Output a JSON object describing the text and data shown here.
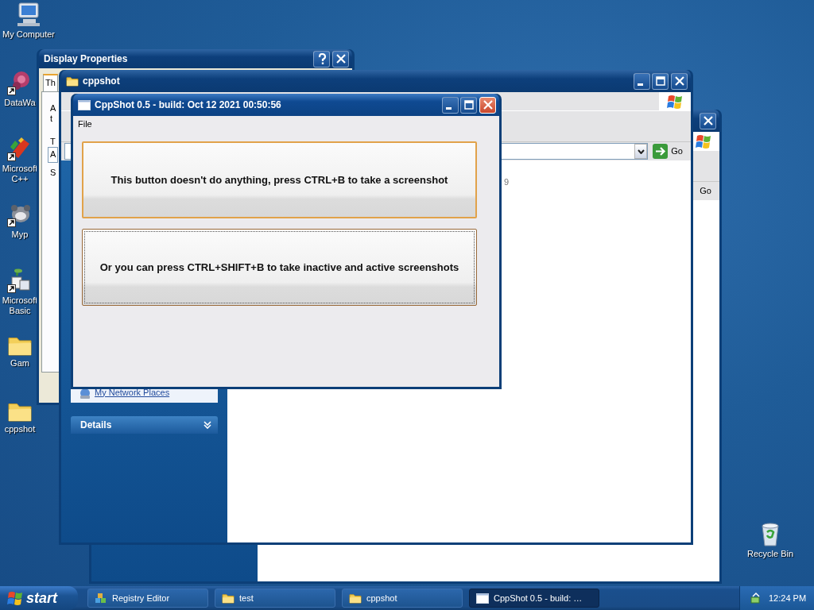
{
  "desktop_icons": [
    {
      "label": "My Computer",
      "kind": "computer",
      "shortcut": false
    },
    {
      "label": "DataWa",
      "kind": "flower",
      "shortcut": true
    },
    {
      "label": "Microsoft C++",
      "kind": "pencil",
      "shortcut": true
    },
    {
      "label": "Myp",
      "kind": "animal",
      "shortcut": true
    },
    {
      "label": "Microsoft Basic",
      "kind": "blocks",
      "shortcut": true
    },
    {
      "label": "Gam",
      "kind": "folder",
      "shortcut": false
    },
    {
      "label": "cppshot",
      "kind": "folder",
      "shortcut": false
    }
  ],
  "recycle_bin": {
    "label": "Recycle Bin"
  },
  "back_explorer": {
    "active": false,
    "go_label": "Go"
  },
  "display_properties": {
    "title": "Display Properties",
    "active": false,
    "tab": {
      "label": "Th",
      "selected": true
    },
    "fragments": [
      {
        "text": "A",
        "kind": "label"
      },
      {
        "text": "t",
        "kind": "label"
      },
      {
        "text": "T",
        "kind": "label"
      },
      {
        "text": "A",
        "kind": "field"
      },
      {
        "text": "S",
        "kind": "label"
      }
    ]
  },
  "explorer": {
    "title": "cppshot",
    "active": false,
    "go_label": "Go",
    "fragment": "9",
    "task_link": "My Network Places",
    "details": {
      "label": "Details",
      "expanded": false
    }
  },
  "cppshot": {
    "title": "CppShot 0.5 - build: Oct 12 2021 00:50:56",
    "active": true,
    "menu": [
      "File"
    ],
    "buttons": [
      {
        "label": "This button doesn't do anything, press CTRL+B to take a screenshot",
        "focused": false
      },
      {
        "label": "Or you can press CTRL+SHIFT+B to take inactive and active screenshots",
        "focused": true
      }
    ]
  },
  "taskbar": {
    "start": "start",
    "items": [
      {
        "label": "Registry Editor",
        "kind": "registry",
        "selected": false
      },
      {
        "label": "test",
        "kind": "folder",
        "selected": false
      },
      {
        "label": "cppshot",
        "kind": "folder",
        "selected": false
      },
      {
        "label": "CppShot 0.5 - build: …",
        "kind": "window",
        "selected": true
      }
    ],
    "clock": "12:24 PM"
  }
}
